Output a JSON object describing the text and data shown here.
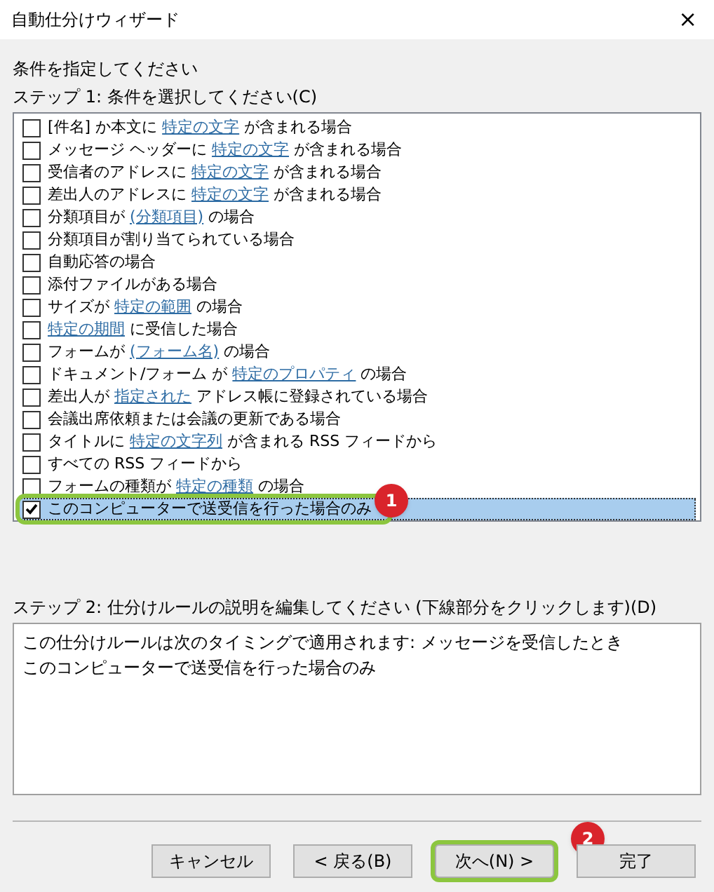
{
  "window": {
    "title": "自動仕分けウィザード",
    "close": "×"
  },
  "heading": "条件を指定してください",
  "step1": {
    "label": "ステップ 1: 条件を選択してください(C)",
    "conditions": [
      {
        "checked": false,
        "selected": false,
        "parts": [
          {
            "text": "[件名] か本文に ",
            "link": false
          },
          {
            "text": "特定の文字",
            "link": true
          },
          {
            "text": " が含まれる場合",
            "link": false
          }
        ]
      },
      {
        "checked": false,
        "selected": false,
        "parts": [
          {
            "text": "メッセージ ヘッダーに ",
            "link": false
          },
          {
            "text": "特定の文字",
            "link": true
          },
          {
            "text": " が含まれる場合",
            "link": false
          }
        ]
      },
      {
        "checked": false,
        "selected": false,
        "parts": [
          {
            "text": "受信者のアドレスに ",
            "link": false
          },
          {
            "text": "特定の文字",
            "link": true
          },
          {
            "text": " が含まれる場合",
            "link": false
          }
        ]
      },
      {
        "checked": false,
        "selected": false,
        "parts": [
          {
            "text": "差出人のアドレスに ",
            "link": false
          },
          {
            "text": "特定の文字",
            "link": true
          },
          {
            "text": " が含まれる場合",
            "link": false
          }
        ]
      },
      {
        "checked": false,
        "selected": false,
        "parts": [
          {
            "text": "分類項目が ",
            "link": false
          },
          {
            "text": "(分類項目)",
            "link": true
          },
          {
            "text": " の場合",
            "link": false
          }
        ]
      },
      {
        "checked": false,
        "selected": false,
        "parts": [
          {
            "text": "分類項目が割り当てられている場合",
            "link": false
          }
        ]
      },
      {
        "checked": false,
        "selected": false,
        "parts": [
          {
            "text": "自動応答の場合",
            "link": false
          }
        ]
      },
      {
        "checked": false,
        "selected": false,
        "parts": [
          {
            "text": "添付ファイルがある場合",
            "link": false
          }
        ]
      },
      {
        "checked": false,
        "selected": false,
        "parts": [
          {
            "text": "サイズが ",
            "link": false
          },
          {
            "text": "特定の範囲",
            "link": true
          },
          {
            "text": " の場合",
            "link": false
          }
        ]
      },
      {
        "checked": false,
        "selected": false,
        "parts": [
          {
            "text": "特定の期間",
            "link": true
          },
          {
            "text": " に受信した場合",
            "link": false
          }
        ]
      },
      {
        "checked": false,
        "selected": false,
        "parts": [
          {
            "text": "フォームが ",
            "link": false
          },
          {
            "text": "(フォーム名)",
            "link": true
          },
          {
            "text": " の場合",
            "link": false
          }
        ]
      },
      {
        "checked": false,
        "selected": false,
        "parts": [
          {
            "text": "ドキュメント/フォーム が ",
            "link": false
          },
          {
            "text": "特定のプロパティ",
            "link": true
          },
          {
            "text": " の場合",
            "link": false
          }
        ]
      },
      {
        "checked": false,
        "selected": false,
        "parts": [
          {
            "text": "差出人が ",
            "link": false
          },
          {
            "text": "指定された",
            "link": true
          },
          {
            "text": " アドレス帳に登録されている場合",
            "link": false
          }
        ]
      },
      {
        "checked": false,
        "selected": false,
        "parts": [
          {
            "text": "会議出席依頼または会議の更新である場合",
            "link": false
          }
        ]
      },
      {
        "checked": false,
        "selected": false,
        "parts": [
          {
            "text": "タイトルに ",
            "link": false
          },
          {
            "text": "特定の文字列",
            "link": true
          },
          {
            "text": " が含まれる RSS フィードから",
            "link": false
          }
        ]
      },
      {
        "checked": false,
        "selected": false,
        "parts": [
          {
            "text": "すべての RSS フィードから",
            "link": false
          }
        ]
      },
      {
        "checked": false,
        "selected": false,
        "parts": [
          {
            "text": "フォームの種類が ",
            "link": false
          },
          {
            "text": "特定の種類",
            "link": true
          },
          {
            "text": " の場合",
            "link": false
          }
        ]
      },
      {
        "checked": true,
        "selected": true,
        "callout": "1",
        "parts": [
          {
            "text": "このコンピューターで送受信を行った場合のみ",
            "link": false
          }
        ]
      }
    ]
  },
  "step2": {
    "label": "ステップ 2: 仕分けルールの説明を編集してください (下線部分をクリックします)(D)",
    "lines": [
      "この仕分けルールは次のタイミングで適用されます: メッセージを受信したとき",
      "このコンピューターで送受信を行った場合のみ"
    ]
  },
  "buttons": [
    {
      "label": "キャンセル"
    },
    {
      "label": "< 戻る(B)"
    },
    {
      "label": "次へ(N) >",
      "callout": "2"
    },
    {
      "label": "完了"
    }
  ]
}
